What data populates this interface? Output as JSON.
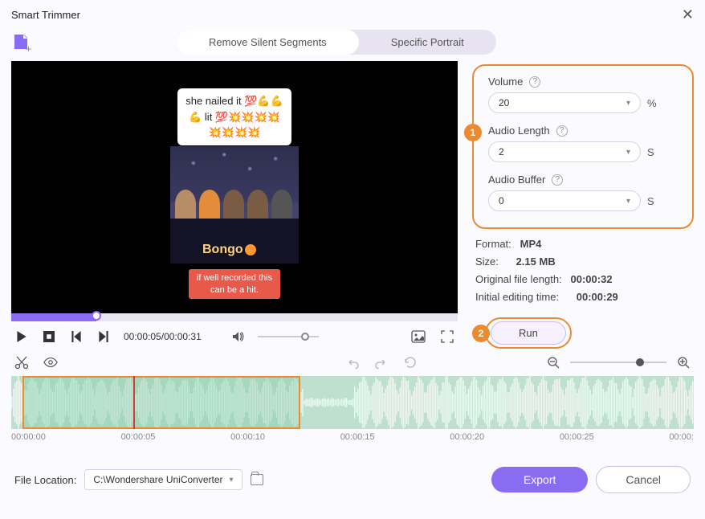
{
  "window": {
    "title": "Smart Trimmer"
  },
  "tabs": {
    "remove_silent": "Remove Silent Segments",
    "specific_portrait": "Specific Portrait"
  },
  "preview": {
    "sticker_line1": "she nailed it 💯💪💪",
    "sticker_line2": "💪 lit 💯💥💥💥💥",
    "sticker_line3": "💥💥💥💥",
    "banner": "Bongo",
    "caption_line1": "if well recorded this",
    "caption_line2": "can be a hit."
  },
  "transport": {
    "current": "00:00:05",
    "total": "00:00:31"
  },
  "params": {
    "volume_label": "Volume",
    "volume_value": "20",
    "volume_unit": "%",
    "length_label": "Audio Length",
    "length_value": "2",
    "length_unit": "S",
    "buffer_label": "Audio Buffer",
    "buffer_value": "0",
    "buffer_unit": "S"
  },
  "info": {
    "format_label": "Format:",
    "format_value": "MP4",
    "size_label": "Size:",
    "size_value": "2.15 MB",
    "orig_label": "Original file length:",
    "orig_value": "00:00:32",
    "init_label": "Initial editing time:",
    "init_value": "00:00:29"
  },
  "buttons": {
    "run": "Run",
    "export": "Export",
    "cancel": "Cancel"
  },
  "ruler": [
    "00:00:00",
    "00:00:05",
    "00:00:10",
    "00:00:15",
    "00:00:20",
    "00:00:25",
    "00:00:"
  ],
  "footer": {
    "loc_label": "File Location:",
    "loc_value": "C:\\Wondershare UniConverter"
  },
  "steps": {
    "s1": "1",
    "s2": "2"
  }
}
